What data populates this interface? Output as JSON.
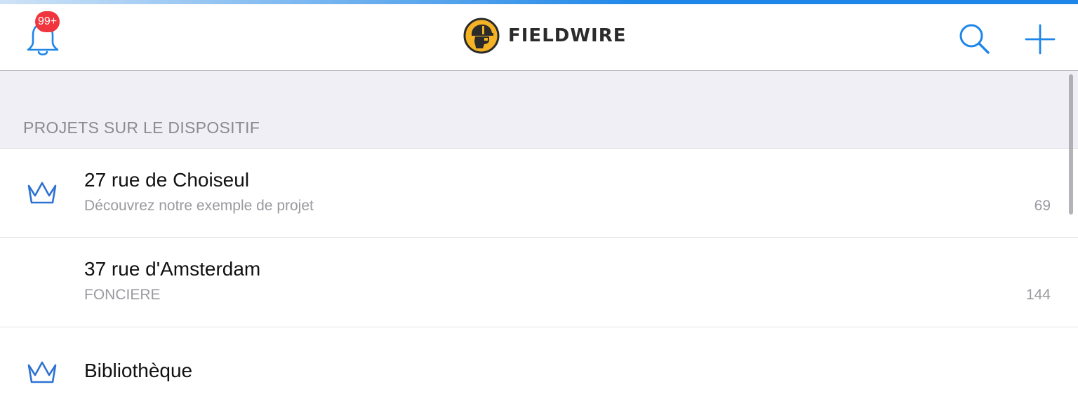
{
  "app": {
    "brand_name": "FIELDWIRE",
    "brand_logo_icon": "worker-helmet-logo",
    "accent_color": "#1d86e8",
    "badge_color": "#f0353e",
    "load_progress": 1.0
  },
  "navbar": {
    "notifications_icon": "bell-icon",
    "notifications_badge": "99+",
    "search_icon": "search-icon",
    "add_icon": "plus-icon"
  },
  "section": {
    "title": "PROJETS SUR LE DISPOSITIF"
  },
  "projects": [
    {
      "title": "27 rue de Choiseul",
      "subtitle": "Découvrez notre exemple de projet",
      "count": "69",
      "icon": "crown-icon"
    },
    {
      "title": "37 rue d'Amsterdam",
      "subtitle": "FONCIERE",
      "count": "144",
      "icon": ""
    },
    {
      "title": "Bibliothèque",
      "subtitle": "",
      "count": "",
      "icon": "crown-icon"
    }
  ]
}
